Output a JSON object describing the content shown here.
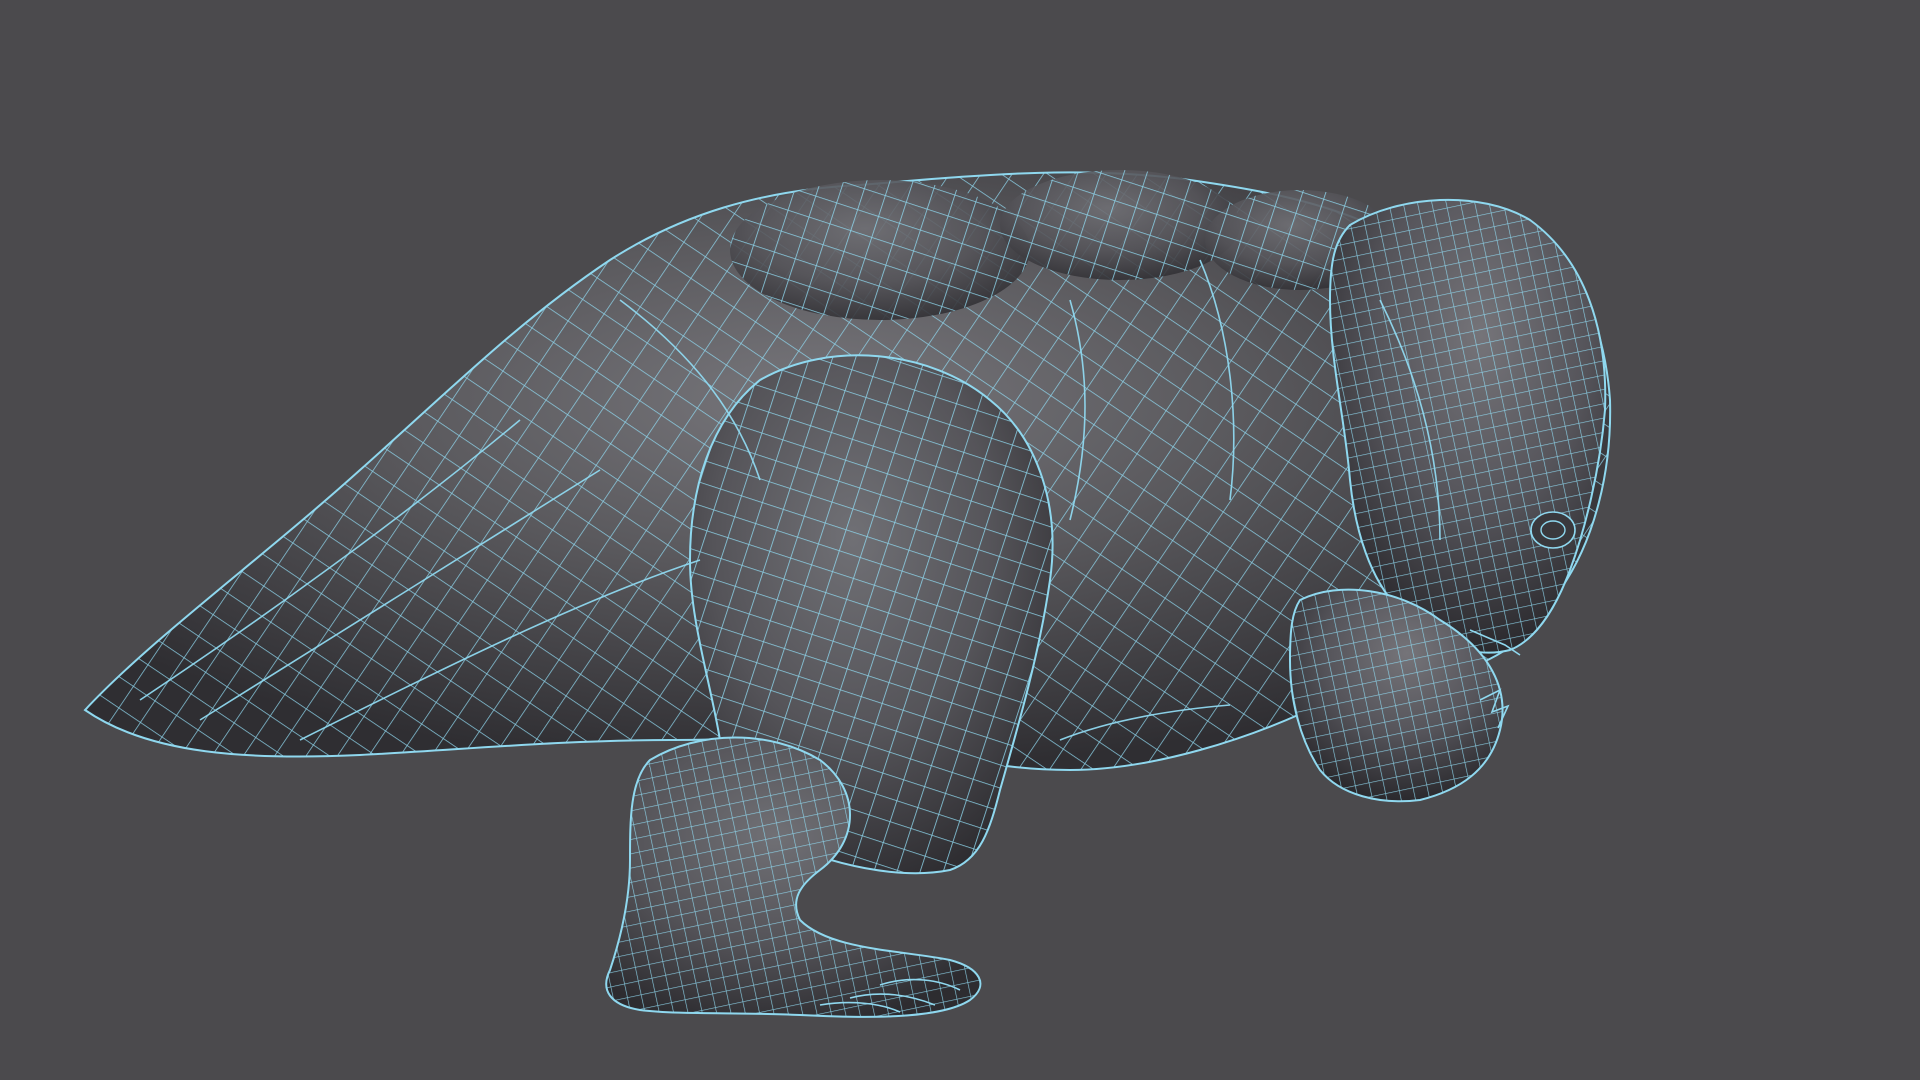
{
  "viewport": {
    "background": "#4b4a4d",
    "mode": "wireframe-on-shaded"
  },
  "model": {
    "subject": "creature-model",
    "surface_color": "#5b5a5e",
    "shade_color": "#2c2b2f",
    "highlight_color": "#7b7a7f",
    "wire_color": "#8fd8ef"
  }
}
